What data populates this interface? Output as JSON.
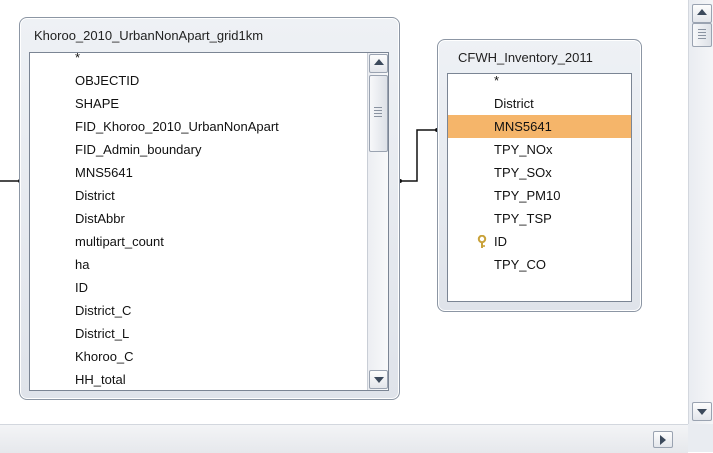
{
  "tables": [
    {
      "title": "Khoroo_2010_UrbanNonApart_grid1km",
      "fields": [
        "*",
        "OBJECTID",
        "SHAPE",
        "FID_Khoroo_2010_UrbanNonApart",
        "FID_Admin_boundary",
        "MNS5641",
        "District",
        "DistAbbr",
        "multipart_count",
        "ha",
        "ID",
        "District_C",
        "District_L",
        "Khoroo_C",
        "HH_total"
      ]
    },
    {
      "title": "CFWH_Inventory_2011",
      "fields": [
        "*",
        "District",
        "MNS5641",
        "TPY_NOx",
        "TPY_SOx",
        "TPY_PM10",
        "TPY_TSP",
        "ID",
        "TPY_CO"
      ],
      "selected_field": "MNS5641",
      "primary_key_field": "ID"
    }
  ],
  "colors": {
    "selection": "#f5b56a",
    "relationship_line": "#111111",
    "key_icon": "#c9a23a"
  },
  "icons": {
    "key": "key-icon",
    "scroll_up": "chevron-up-icon",
    "scroll_down": "chevron-down-icon",
    "scroll_right": "chevron-right-icon"
  }
}
